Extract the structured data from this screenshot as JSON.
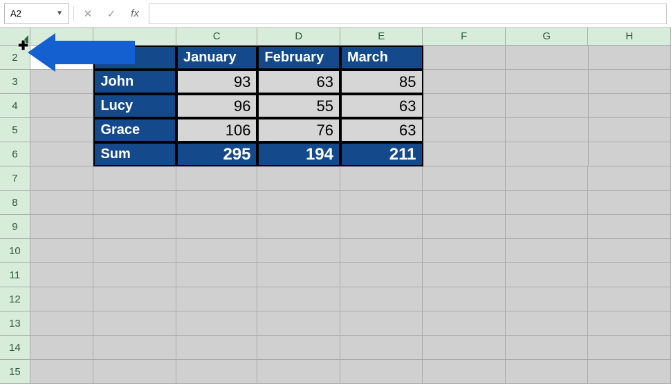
{
  "namebox": "A2",
  "formula": "",
  "columns": [
    "C",
    "D",
    "E",
    "F",
    "G",
    "H"
  ],
  "rows": [
    "2",
    "3",
    "4",
    "5",
    "6",
    "7",
    "8",
    "9",
    "10",
    "11",
    "12",
    "13",
    "14",
    "15"
  ],
  "table": {
    "headers": {
      "c": "January",
      "d": "February",
      "e": "March"
    },
    "rowLabels": {
      "r3": "John",
      "r4": "Lucy",
      "r5": "Grace",
      "r6": "Sum"
    },
    "data": {
      "r3": {
        "c": "93",
        "d": "63",
        "e": "85"
      },
      "r4": {
        "c": "96",
        "d": "55",
        "e": "63"
      },
      "r5": {
        "c": "106",
        "d": "76",
        "e": "63"
      },
      "r6": {
        "c": "295",
        "d": "194",
        "e": "211"
      }
    }
  },
  "chart_data": {
    "type": "table",
    "title": "",
    "columns": [
      "January",
      "February",
      "March"
    ],
    "rows": [
      "John",
      "Lucy",
      "Grace",
      "Sum"
    ],
    "values": [
      [
        93,
        63,
        85
      ],
      [
        96,
        55,
        63
      ],
      [
        106,
        76,
        63
      ],
      [
        295,
        194,
        211
      ]
    ]
  }
}
